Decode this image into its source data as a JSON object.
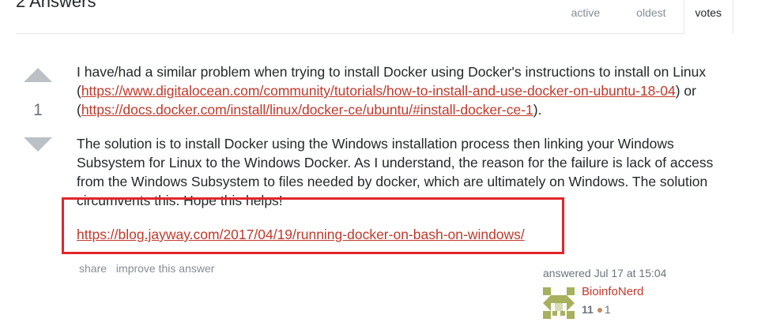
{
  "header": {
    "answers_count": "2 Answers",
    "tabs": [
      {
        "label": "active"
      },
      {
        "label": "oldest"
      },
      {
        "label": "votes"
      }
    ]
  },
  "vote": {
    "count": "1"
  },
  "post": {
    "para1": {
      "text_before": "I have/had a similar problem when trying to install Docker using Docker's instructions to install on Linux (",
      "link1": "https://www.digitalocean.com/community/tutorials/how-to-install-and-use-docker-on-ubuntu-18-04",
      "text_middle": ") or (",
      "link2": "https://docs.docker.com/install/linux/docker-ce/ubuntu/#install-docker-ce-1",
      "text_after": ")."
    },
    "para2": "The solution is to install Docker using the Windows installation process then linking your Windows Subsystem for Linux to the Windows Docker. As I understand, the reason for the failure is lack of access from the Windows Subsystem to files needed by docker, which are ultimately on Windows. The solution circumvents this. Hope this helps!",
    "link3": "https://blog.jayway.com/2017/04/19/running-docker-on-bash-on-windows/"
  },
  "post_menu": {
    "share": "share",
    "improve": "improve this answer"
  },
  "user": {
    "action_time": "answered Jul 17 at 15:04",
    "name": "BioinfoNerd",
    "reputation": "11",
    "bronze_badges": "1"
  },
  "colors": {
    "link": "#c0392b",
    "highlight_border": "#e0262b"
  }
}
